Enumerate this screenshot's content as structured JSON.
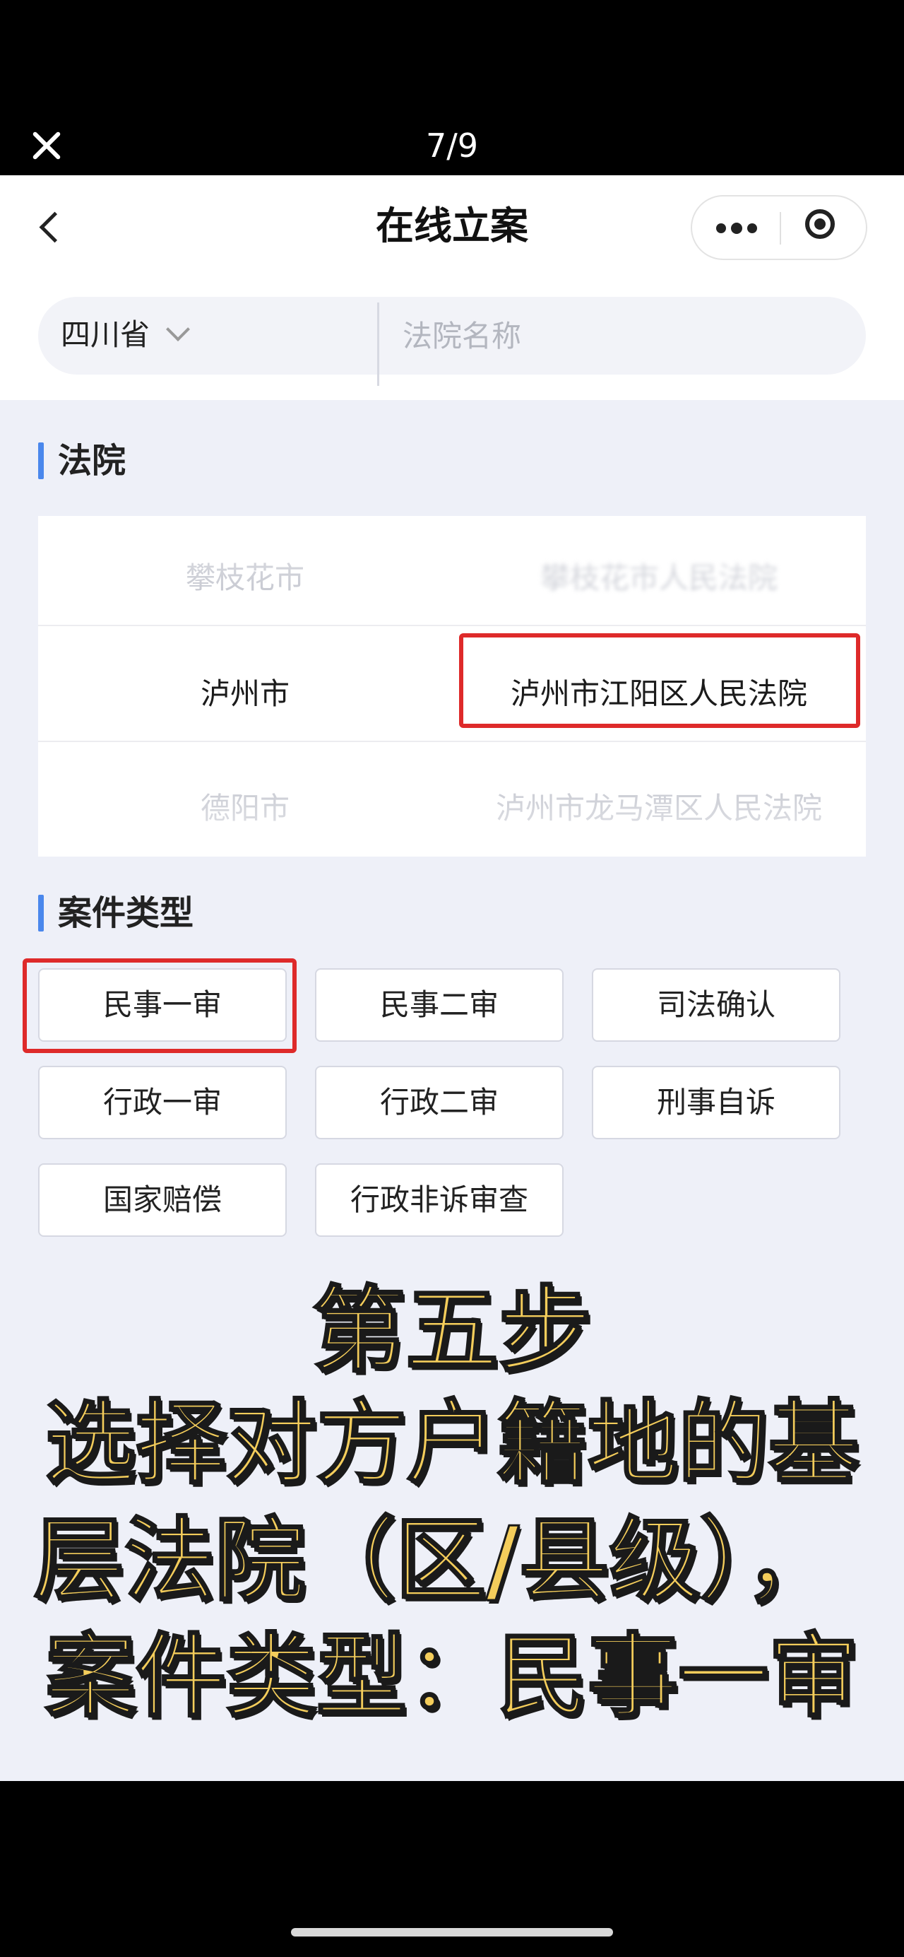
{
  "viewer": {
    "counter": "7/9"
  },
  "navbar": {
    "title": "在线立案"
  },
  "search": {
    "province": "四川省",
    "placeholder": "法院名称"
  },
  "court_section": {
    "title": "法院",
    "rows": [
      {
        "city": "攀枝花市",
        "court": "攀枝花市人民法院"
      },
      {
        "city": "泸州市",
        "court": "泸州市江阳区人民法院"
      },
      {
        "city": "德阳市",
        "court": "泸州市龙马潭区人民法院"
      }
    ]
  },
  "case_section": {
    "title": "案件类型",
    "types": [
      "民事一审",
      "民事二审",
      "司法确认",
      "行政一审",
      "行政二审",
      "刑事自诉",
      "国家赔偿",
      "行政非诉审查"
    ]
  },
  "caption": {
    "line1": "第五步",
    "line2": "选择对方户籍地的基",
    "line3": "层法院（区/县级），",
    "line4": "案件类型：民事一审"
  },
  "colors": {
    "accent": "#4a87ec",
    "highlight": "#de2a2a",
    "caption": "#f4cd5b"
  }
}
